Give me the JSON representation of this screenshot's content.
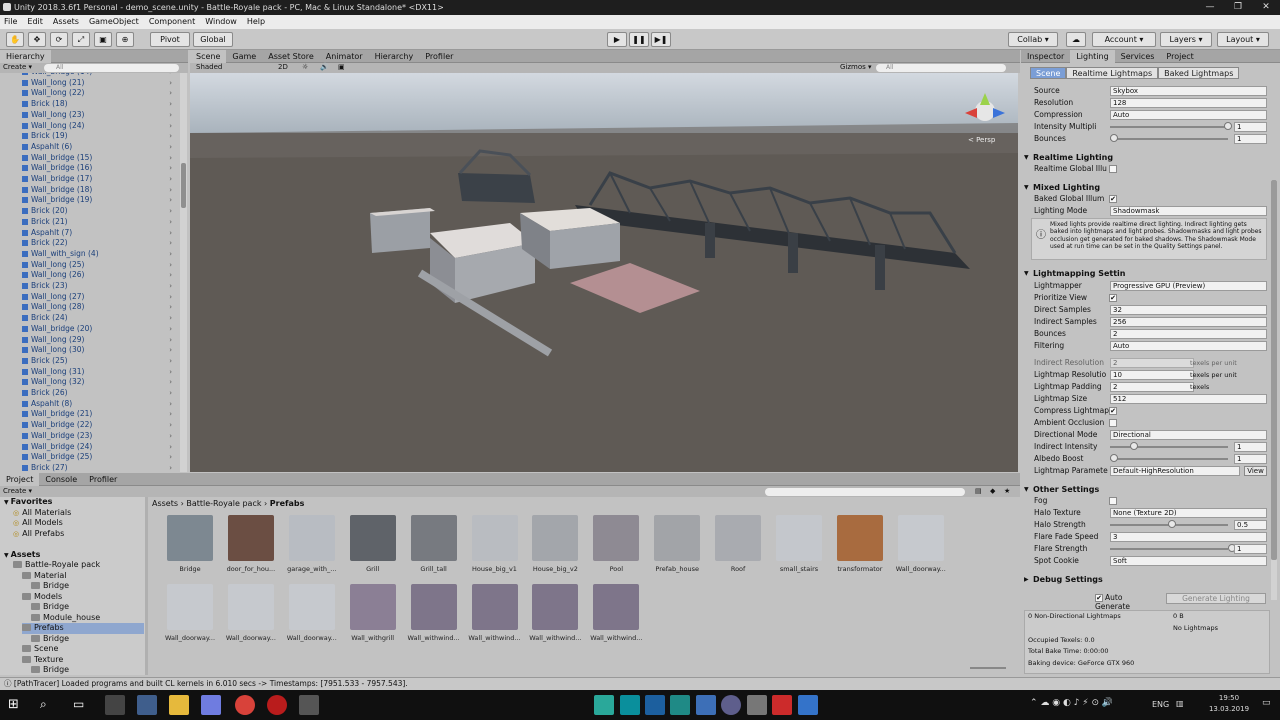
{
  "window": {
    "title": "Unity 2018.3.6f1 Personal - demo_scene.unity - Battle-Royale pack - PC, Mac & Linux Standalone* <DX11>"
  },
  "menu": [
    "File",
    "Edit",
    "Assets",
    "GameObject",
    "Component",
    "Window",
    "Help"
  ],
  "toolbar": {
    "pivot": "Pivot",
    "global": "Global",
    "collab": "Collab ▾",
    "account": "Account ▾",
    "layers": "Layers ▾",
    "layout": "Layout ▾"
  },
  "hierarchy": {
    "tab": "Hierarchy",
    "create": "Create ▾",
    "search_placeholder": "All",
    "items": [
      "Wall_bridge (14)",
      "Wall_long (21)",
      "Wall_long (22)",
      "Brick (18)",
      "Wall_long (23)",
      "Wall_long (24)",
      "Brick (19)",
      "Aspahlt (6)",
      "Wall_bridge (15)",
      "Wall_bridge (16)",
      "Wall_bridge (17)",
      "Wall_bridge (18)",
      "Wall_bridge (19)",
      "Brick (20)",
      "Brick (21)",
      "Aspahlt (7)",
      "Brick (22)",
      "Wall_with_sign (4)",
      "Wall_long (25)",
      "Wall_long (26)",
      "Brick (23)",
      "Wall_long (27)",
      "Wall_long (28)",
      "Brick (24)",
      "Wall_bridge (20)",
      "Wall_long (29)",
      "Wall_long (30)",
      "Brick (25)",
      "Wall_long (31)",
      "Wall_long (32)",
      "Brick (26)",
      "Aspahlt (8)",
      "Wall_bridge (21)",
      "Wall_bridge (22)",
      "Wall_bridge (23)",
      "Wall_bridge (24)",
      "Wall_bridge (25)",
      "Brick (27)"
    ]
  },
  "scene_tabs": [
    "Scene",
    "Game",
    "Asset Store",
    "Animator",
    "Hierarchy",
    "Profiler"
  ],
  "scene_bar": {
    "shaded": "Shaded",
    "mode2d": "2D",
    "gizmos": "Gizmos ▾",
    "search_placeholder": "All",
    "persp": "< Persp"
  },
  "inspector": {
    "tabs": [
      "Inspector",
      "Lighting",
      "Services",
      "Project"
    ],
    "subtabs": [
      "Scene",
      "Realtime Lightmaps",
      "Baked Lightmaps"
    ],
    "env": [
      {
        "label": "Source",
        "value": "Skybox"
      },
      {
        "label": "Resolution",
        "value": "128"
      },
      {
        "label": "Compression",
        "value": "Auto"
      },
      {
        "label": "Intensity Multipli",
        "value": "1"
      },
      {
        "label": "Bounces",
        "value": "1"
      }
    ],
    "realtime": {
      "title": "Realtime Lighting",
      "gi": "Realtime Global Illu"
    },
    "mixed": {
      "title": "Mixed Lighting",
      "baked": "Baked Global Illum",
      "mode_label": "Lighting Mode",
      "mode": "Shadowmask",
      "help": "Mixed lights provide realtime direct lighting. Indirect lighting gets baked into lightmaps and light probes. Shadowmasks and light probes occlusion get generated for baked shadows. The Shadowmask Mode used at run time can be set in the Quality Settings panel."
    },
    "lm": {
      "title": "Lightmapping Settin",
      "rows": [
        {
          "label": "Lightmapper",
          "value": "Progressive GPU (Preview)"
        },
        {
          "label": "Prioritize View",
          "value": "✔"
        },
        {
          "label": "Direct Samples",
          "value": "32"
        },
        {
          "label": "Indirect Samples",
          "value": "256"
        },
        {
          "label": "Bounces",
          "value": "2"
        },
        {
          "label": "Filtering",
          "value": "Auto"
        },
        {
          "label": "Indirect Resolution",
          "value": "2",
          "unit": "texels per unit"
        },
        {
          "label": "Lightmap Resolutio",
          "value": "10",
          "unit": "texels per unit"
        },
        {
          "label": "Lightmap Padding",
          "value": "2",
          "unit": "texels"
        },
        {
          "label": "Lightmap Size",
          "value": "512"
        },
        {
          "label": "Compress Lightmap",
          "value": "✔"
        },
        {
          "label": "Ambient Occlusion",
          "value": ""
        },
        {
          "label": "Directional Mode",
          "value": "Directional"
        },
        {
          "label": "Indirect Intensity",
          "value": "1"
        },
        {
          "label": "Albedo Boost",
          "value": "1"
        },
        {
          "label": "Lightmap Paramete",
          "value": "Default-HighResolution",
          "extra": "View"
        }
      ]
    },
    "other": {
      "title": "Other Settings",
      "rows": [
        {
          "label": "Fog",
          "value": ""
        },
        {
          "label": "Halo Texture",
          "value": "None (Texture 2D)"
        },
        {
          "label": "Halo Strength",
          "value": "0.5"
        },
        {
          "label": "Flare Fade Speed",
          "value": "3"
        },
        {
          "label": "Flare Strength",
          "value": "1"
        },
        {
          "label": "Spot Cookie",
          "value": "Soft"
        }
      ]
    },
    "debug": "Debug Settings",
    "auto_generate": "Auto Generate",
    "generate": "Generate Lighting",
    "stats": {
      "nondir": "0 Non-Directional Lightmaps",
      "size": "0 B",
      "nolm": "No Lightmaps",
      "texels": "Occupied Texels: 0.0",
      "bake": "Total Bake Time: 0:00:00",
      "device": "Baking device: GeForce GTX 960"
    }
  },
  "project": {
    "tabs": [
      "Project",
      "Console",
      "Profiler"
    ],
    "create": "Create ▾",
    "breadcrumb": [
      "Assets",
      "Battle-Royale pack",
      "Prefabs"
    ],
    "tree": [
      {
        "t": "Favorites",
        "l": 0,
        "b": true
      },
      {
        "t": "All Materials",
        "l": 1
      },
      {
        "t": "All Models",
        "l": 1
      },
      {
        "t": "All Prefabs",
        "l": 1
      },
      {
        "t": "",
        "l": 0
      },
      {
        "t": "Assets",
        "l": 0,
        "b": true
      },
      {
        "t": "Battle-Royale pack",
        "l": 1
      },
      {
        "t": "Material",
        "l": 2
      },
      {
        "t": "Bridge",
        "l": 3
      },
      {
        "t": "Models",
        "l": 2
      },
      {
        "t": "Bridge",
        "l": 3
      },
      {
        "t": "Module_house",
        "l": 3
      },
      {
        "t": "Prefabs",
        "l": 2,
        "sel": true
      },
      {
        "t": "Bridge",
        "l": 3
      },
      {
        "t": "Scene",
        "l": 2
      },
      {
        "t": "Texture",
        "l": 2
      },
      {
        "t": "Bridge",
        "l": 3
      }
    ],
    "assets": [
      "Bridge",
      "door_for_hou...",
      "garage_with_...",
      "Grill",
      "Grill_tall",
      "House_big_v1",
      "House_big_v2",
      "Pool",
      "Prefab_house",
      "Roof",
      "small_stairs",
      "transformator",
      "Wall_doorway...",
      "Wall_doorway...",
      "Wall_doorway...",
      "Wall_doorway...",
      "Wall_withgrill",
      "Wall_withwind...",
      "Wall_withwind...",
      "Wall_withwind...",
      "Wall_withwind..."
    ]
  },
  "status": "[PathTracer] Loaded programs and built CL kernels in 6.010 secs -> Timestamps: [7951.533 - 7957.543].",
  "taskbar": {
    "lang": "ENG",
    "time": "19:50",
    "date": "13.03.2019"
  },
  "colors": {
    "scene_sky": "#c4ccd6",
    "scene_ground": "#5f5a55",
    "accent": "#3b6dbf"
  }
}
